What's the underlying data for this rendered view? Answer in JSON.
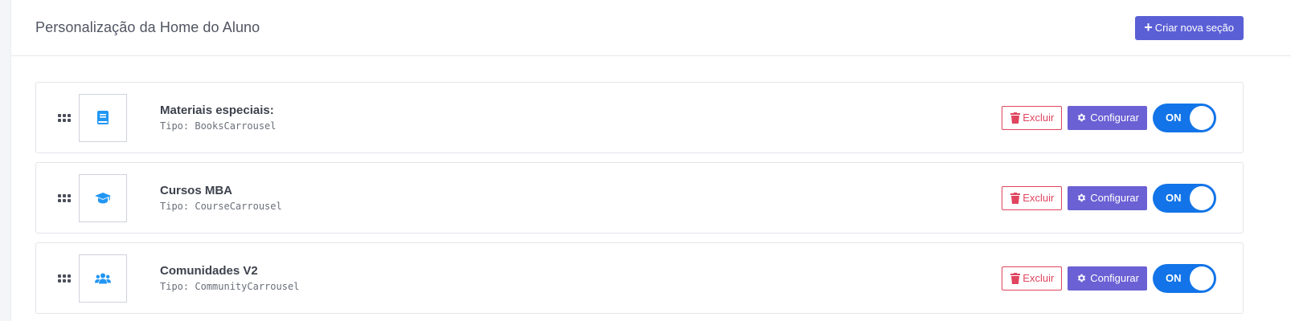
{
  "header": {
    "title": "Personalização da Home do Aluno",
    "create_button_label": "Criar nova seção"
  },
  "colors": {
    "primary": "#5b5fd6",
    "configure": "#6b60d4",
    "danger": "#e0455f",
    "toggle_on": "#1274e8",
    "icon": "#2196f3"
  },
  "sections": [
    {
      "name": "Materiais especiais:",
      "type": "Tipo: BooksCarrousel",
      "icon": "book-icon",
      "delete_label": "Excluir",
      "configure_label": "Configurar",
      "toggle_label": "ON",
      "enabled": true
    },
    {
      "name": "Cursos MBA",
      "type": "Tipo: CourseCarrousel",
      "icon": "graduation-cap-icon",
      "delete_label": "Excluir",
      "configure_label": "Configurar",
      "toggle_label": "ON",
      "enabled": true
    },
    {
      "name": "Comunidades V2",
      "type": "Tipo: CommunityCarrousel",
      "icon": "users-icon",
      "delete_label": "Excluir",
      "configure_label": "Configurar",
      "toggle_label": "ON",
      "enabled": true
    }
  ]
}
